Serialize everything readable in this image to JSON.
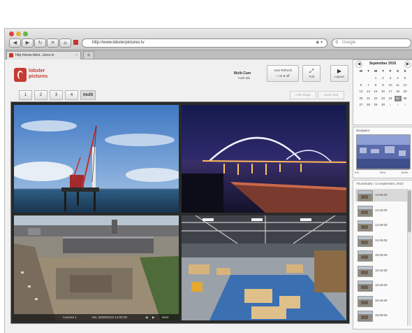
{
  "browser": {
    "back_icon": "back-arrow-icon",
    "forward_icon": "forward-arrow-icon",
    "reload_icon": "reload-icon",
    "home_icon": "home-icon",
    "url": "http://www.lobsterpictures.tv",
    "search_placeholder": "Google",
    "tab_title": "http://www.lobst...tures.tv",
    "new_tab_label": "+"
  },
  "app": {
    "logo_line1": "lobster",
    "logo_line2": "pictures",
    "mode_title": "Multi-Cam",
    "mode_subtitle": "multi tab",
    "auto_refresh": {
      "label": "Auto Refresh",
      "on": "on",
      "off": "off"
    },
    "buttons": [
      {
        "label": "Full",
        "icon": "fullscreen-icon"
      },
      {
        "label": "Layout",
        "icon": "layout-icon"
      }
    ],
    "camera_tabs": [
      "1",
      "2",
      "3",
      "4",
      "multi"
    ],
    "active_tab": "multi",
    "ghost_buttons": [
      "Add Image",
      "Save Grid"
    ],
    "viewer": {
      "camera": "Camera 1",
      "timestamp": "Mo, 06/09/2010 14:00:00",
      "prev": "◀",
      "next": "▶",
      "next_label": "Next"
    }
  },
  "calendar": {
    "month": "September",
    "year": "2010",
    "weekdays": [
      "M",
      "T",
      "W",
      "T",
      "F",
      "S",
      "S"
    ],
    "days": [
      "",
      "",
      "1",
      "2",
      "3",
      "4",
      "5",
      "6",
      "7",
      "8",
      "9",
      "10",
      "11",
      "12",
      "13",
      "14",
      "15",
      "16",
      "17",
      "18",
      "19",
      "20",
      "21",
      "22",
      "23",
      "24",
      "25",
      "26",
      "27",
      "28",
      "29",
      "30",
      "1",
      "2",
      "3"
    ],
    "selected_day": "25"
  },
  "navigator": {
    "title": "Navigator",
    "zoom_min": "0%",
    "zoom_mid": "50%",
    "zoom_max": "100%"
  },
  "thumbnails": {
    "title": "Thumbnails / 14 September, 2010",
    "items": [
      "14:00:00",
      "14:15:00",
      "14:30:00",
      "14:45:00",
      "15:00:00",
      "15:15:00",
      "15:30:00",
      "15:45:00",
      "16:00:00"
    ]
  },
  "colors": {
    "accent": "#c63a31"
  }
}
